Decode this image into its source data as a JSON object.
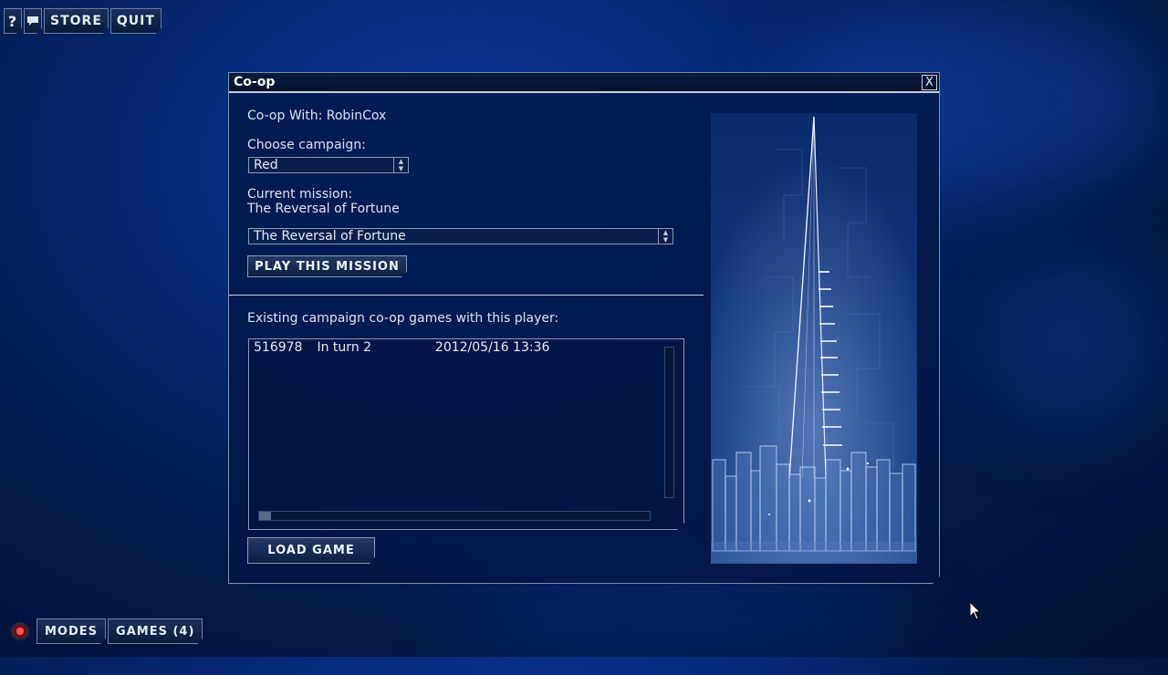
{
  "topbar": {
    "help_icon": "question-icon",
    "chat_icon": "speech-bubble-icon",
    "store_label": "STORE",
    "quit_label": "QUIT"
  },
  "dialog": {
    "title": "Co-op",
    "close_label": "X",
    "coop_with": "Co-op With: RobinCox",
    "choose_campaign_label": "Choose campaign:",
    "campaign_selected": "Red",
    "current_mission_label": "Current mission:",
    "current_mission_name": "The Reversal of Fortune",
    "mission_selected": "The Reversal of Fortune",
    "play_button": "PLAY THIS MISSION",
    "existing_games_label": "Existing campaign co-op games with this player:",
    "games": [
      {
        "id": "516978",
        "status": "In turn 2",
        "date": "2012/05/16 13:36"
      }
    ],
    "load_button": "LOAD GAME"
  },
  "bottombar": {
    "record_icon": "record-icon",
    "modes_label": "MODES",
    "games_label": "GAMES (4)"
  },
  "colors": {
    "background": "#041b4e",
    "panel": "#021646",
    "border": "#8898b8",
    "text": "#d8e2f2"
  }
}
